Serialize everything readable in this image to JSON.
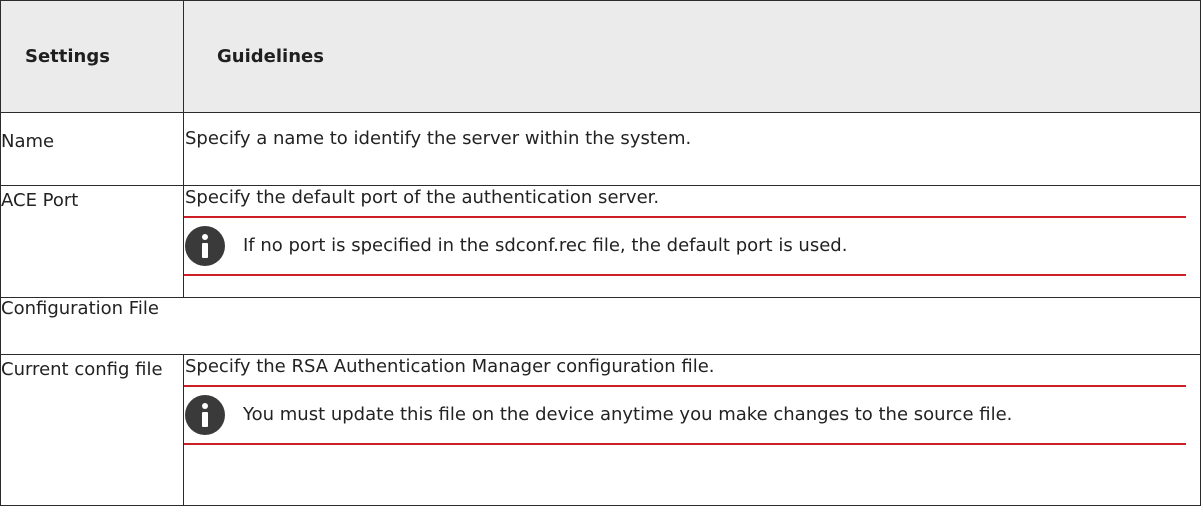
{
  "table": {
    "headers": {
      "settings": "Settings",
      "guidelines": "Guidelines"
    },
    "rows": {
      "name": {
        "setting": "Name",
        "guideline": "Specify a name to identify the server within the system."
      },
      "ace_port": {
        "setting": "ACE Port",
        "guideline": "Specify the default port of the authentication server.",
        "note": "If no port is specified in the sdconf.rec file, the default port is used."
      },
      "configuration_file": {
        "section": "Configuration File"
      },
      "current_config_file": {
        "setting": "Current config file",
        "guideline": "Specify the RSA Authentication Manager configuration file.",
        "note": "You must update this file on the device anytime you make changes to the source file."
      }
    }
  },
  "icons": {
    "note_icon": "info-icon"
  },
  "colors": {
    "header_bg": "#ebebeb",
    "rule_red": "#cc1f26",
    "icon_dark": "#3a3a3a",
    "border": "#2b2b2b"
  }
}
